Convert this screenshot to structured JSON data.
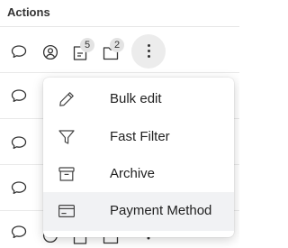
{
  "table": {
    "column_header": "Actions"
  },
  "row_actions": {
    "notes_count": "5",
    "files_count": "2"
  },
  "menu": {
    "items": [
      {
        "label": "Bulk edit",
        "icon": "pencil-icon"
      },
      {
        "label": "Fast Filter",
        "icon": "filter-icon"
      },
      {
        "label": "Archive",
        "icon": "archive-icon"
      },
      {
        "label": "Payment Method",
        "icon": "credit-card-icon"
      }
    ],
    "highlighted_item": "Payment Method"
  },
  "colors": {
    "menu_highlight": "#f1f2f4",
    "badge_bg": "#e3e3e3",
    "more_button_bg": "#ececec",
    "icon_stroke": "#333333"
  }
}
